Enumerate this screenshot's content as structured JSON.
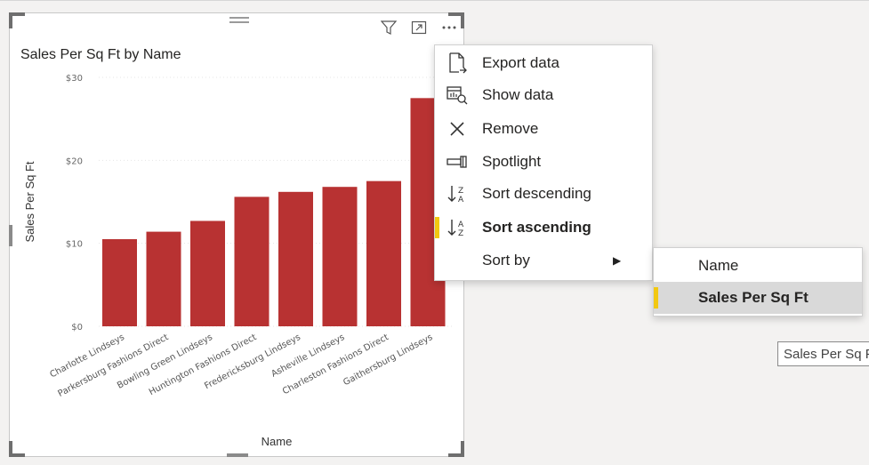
{
  "visual": {
    "title": "Sales Per Sq Ft by Name",
    "header_icons": [
      "funnel-icon",
      "focus-mode-icon",
      "more-options-icon"
    ]
  },
  "chart_data": {
    "type": "bar",
    "title": "Sales Per Sq Ft by Name",
    "xlabel": "Name",
    "ylabel": "Sales Per Sq Ft",
    "categories": [
      "Charlotte Lindseys",
      "Parkersburg Fashions Direct",
      "Bowling Green Lindseys",
      "Huntington Fashions Direct",
      "Fredericksburg Lindseys",
      "Asheville Lindseys",
      "Charleston Fashions Direct",
      "Gaithersburg Lindseys"
    ],
    "values": [
      10.5,
      11.4,
      12.7,
      15.6,
      16.2,
      16.8,
      17.5,
      27.5
    ],
    "yticks": [
      "$0",
      "$10",
      "$20",
      "$30"
    ],
    "ylim": [
      0,
      30
    ],
    "bar_color": "#b83232",
    "grid": true
  },
  "context_menu": {
    "items": [
      {
        "label": "Export data",
        "icon": "export-data-icon"
      },
      {
        "label": "Show data",
        "icon": "show-data-icon"
      },
      {
        "label": "Remove",
        "icon": "close-icon"
      },
      {
        "label": "Spotlight",
        "icon": "spotlight-icon"
      },
      {
        "label": "Sort descending",
        "icon": "sort-descending-icon"
      },
      {
        "label": "Sort ascending",
        "icon": "sort-ascending-icon"
      },
      {
        "label": "Sort by",
        "icon": ""
      }
    ],
    "active_index": 5
  },
  "sort_by_submenu": {
    "items": [
      {
        "label": "Name"
      },
      {
        "label": "Sales Per Sq Ft"
      }
    ],
    "active_index": 1
  },
  "tooltip": {
    "text": "Sales Per Sq Ft"
  },
  "colors": {
    "accent": "#f2c811",
    "bar": "#b83232"
  }
}
